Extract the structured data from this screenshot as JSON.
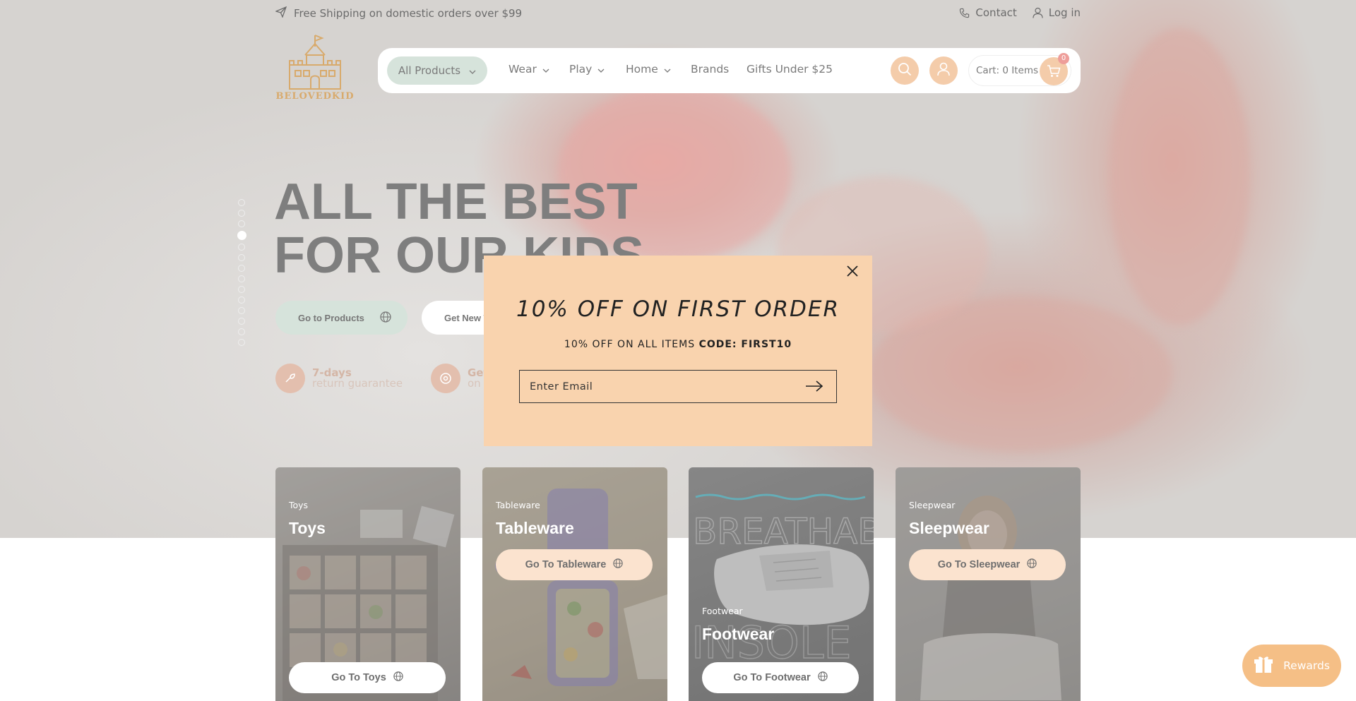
{
  "topbar": {
    "shipping_text": "Free Shipping on domestic orders over $99",
    "contact_label": "Contact",
    "login_label": "Log in"
  },
  "logo": {
    "text": "BELOVEDKID"
  },
  "nav": {
    "all_products": "All Products",
    "items": [
      {
        "label": "Wear"
      },
      {
        "label": "Play"
      },
      {
        "label": "Home"
      },
      {
        "label": "Brands"
      },
      {
        "label": "Gifts Under $25"
      }
    ],
    "cart_label": "Cart: 0 Items",
    "cart_count": "0"
  },
  "hero": {
    "headline": "ALL THE BEST\nFOR OUR KIDS",
    "primary_button": "Go to Products",
    "secondary_button": "Get New T",
    "features": [
      {
        "title": "7-days",
        "subtitle": "return guarantee"
      },
      {
        "title": "Get",
        "subtitle": "on"
      }
    ],
    "slide_count": 14,
    "active_slide": 4
  },
  "categories": [
    {
      "small": "Toys",
      "title": "Toys",
      "button": "Go To Toys"
    },
    {
      "small": "Tableware",
      "title": "Tableware",
      "button": "Go To Tableware"
    },
    {
      "small": "Footwear",
      "title": "Footwear",
      "button": "Go To Footwear"
    },
    {
      "small": "Sleepwear",
      "title": "Sleepwear",
      "button": "Go To Sleepwear"
    }
  ],
  "card_art": {
    "footwear_text_1": "BREATHABLE",
    "footwear_text_2": "INSOLE"
  },
  "modal": {
    "title": "10% OFF ON FIRST ORDER",
    "subtitle_prefix": "10% OFF ON ALL ITEMS ",
    "code_text": "CODE: FIRST10",
    "email_placeholder": "Enter Email"
  },
  "rewards": {
    "label": "Rewards"
  },
  "colors": {
    "accent_peach": "#f4ccaa",
    "modal_bg": "#f9d3ae",
    "mint": "#d6e3db",
    "logo_gold": "#d8aa6c"
  }
}
